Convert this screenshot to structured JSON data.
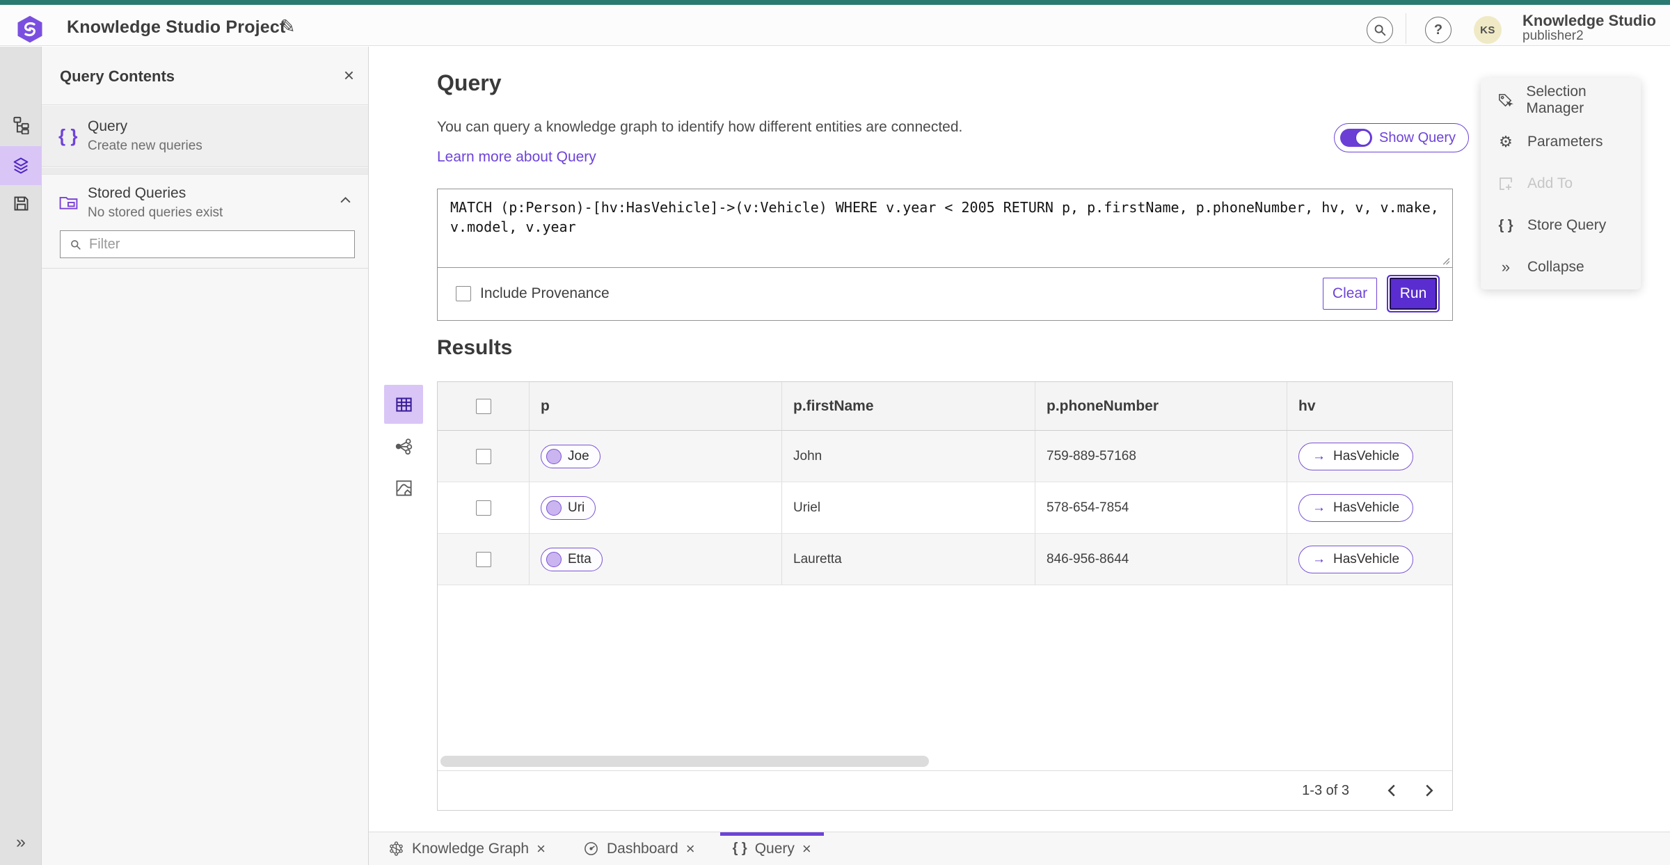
{
  "header": {
    "project_title": "Knowledge Studio Project",
    "app_name": "Knowledge Studio",
    "user_name": "publisher2",
    "avatar_initials": "KS"
  },
  "left_panel": {
    "title": "Query Contents",
    "query_item": {
      "title": "Query",
      "subtitle": "Create new queries"
    },
    "stored_queries": {
      "title": "Stored Queries",
      "subtitle": "No stored queries exist"
    },
    "filter_placeholder": "Filter"
  },
  "query_section": {
    "title": "Query",
    "description": "You can query a knowledge graph to identify how different entities are connected.",
    "learn_more": "Learn more about Query",
    "show_query_label": "Show Query",
    "query_text": "MATCH (p:Person)-[hv:HasVehicle]->(v:Vehicle) WHERE v.year < 2005 RETURN p, p.firstName, p.phoneNumber, hv, v, v.make, v.model, v.year",
    "include_provenance_label": "Include Provenance",
    "clear_label": "Clear",
    "run_label": "Run"
  },
  "results": {
    "title": "Results",
    "columns": [
      "p",
      "p.firstName",
      "p.phoneNumber",
      "hv"
    ],
    "rows": [
      {
        "p": "Joe",
        "firstName": "John",
        "phoneNumber": "759-889-57168",
        "hv": "HasVehicle"
      },
      {
        "p": "Uri",
        "firstName": "Uriel",
        "phoneNumber": "578-654-7854",
        "hv": "HasVehicle"
      },
      {
        "p": "Etta",
        "firstName": "Lauretta",
        "phoneNumber": "846-956-8644",
        "hv": "HasVehicle"
      }
    ],
    "pagination": {
      "label": "1-3 of 3"
    }
  },
  "tools_panel": {
    "items": [
      {
        "label": "Selection Manager",
        "disabled": false
      },
      {
        "label": "Parameters",
        "disabled": false
      },
      {
        "label": "Add To",
        "disabled": true
      },
      {
        "label": "Store Query",
        "disabled": false
      },
      {
        "label": "Collapse",
        "disabled": false
      }
    ]
  },
  "bottom_tabs": [
    {
      "label": "Knowledge Graph",
      "active": false
    },
    {
      "label": "Dashboard",
      "active": false
    },
    {
      "label": "Query",
      "active": true
    }
  ],
  "icons": {
    "close": "×",
    "help": "?",
    "pencil": "✎",
    "braces": "{ }",
    "gear": "⚙",
    "collapse": "»",
    "expand": "»",
    "arrow_right": "→"
  },
  "colors": {
    "accent_teal": "#2a7a72",
    "brand_purple": "#6d43d8",
    "run_button_purple": "#5a2dd1",
    "selected_purple_bg": "#d9c6f6",
    "node_fill_purple": "#cbb5f0",
    "avatar_yellow": "#efeac5",
    "panel_gray": "#f7f7f7",
    "rail_gray": "#e1e1e1"
  }
}
